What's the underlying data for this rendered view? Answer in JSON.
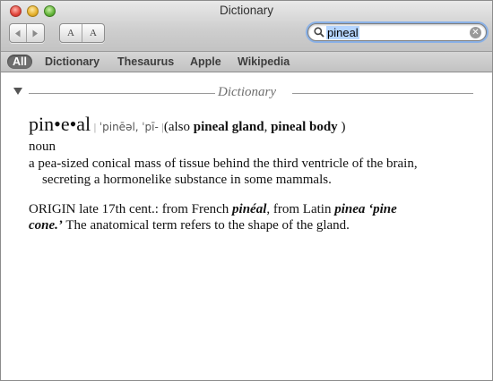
{
  "window": {
    "title": "Dictionary"
  },
  "toolbar": {
    "back_icon": "back-arrow-icon",
    "forward_icon": "forward-arrow-icon",
    "font_smaller_label": "A",
    "font_larger_label": "A"
  },
  "search": {
    "value": "pineal"
  },
  "scopes": [
    "All",
    "Dictionary",
    "Thesaurus",
    "Apple",
    "Wikipedia"
  ],
  "section": {
    "title": "Dictionary"
  },
  "entry": {
    "headword": "pin•e•al",
    "pron1": "ˈpinēəl,",
    "pron2": "ˈpī-",
    "also_open": "(also ",
    "also_term1": "pineal gland",
    "also_comma": ", ",
    "also_term2": "pineal body",
    "also_close": " )",
    "pos": "noun",
    "def_line1": "a pea-sized conical mass of tissue behind the third ventricle of the brain,",
    "def_line2": "secreting a hormonelike substance in some mammals.",
    "origin_a": "ORIGIN late 17th cent.: from French ",
    "origin_b": "pinéal",
    "origin_c": ", from Latin ",
    "origin_d": "pinea ‘pine",
    "origin_e": "cone.’",
    "origin_f": " The anatomical term refers to the shape of the gland."
  },
  "colors": {
    "search_highlight": "#b5d5ff",
    "focus_ring": "#8ab1e6",
    "active_scope": "#6e6e6e"
  }
}
